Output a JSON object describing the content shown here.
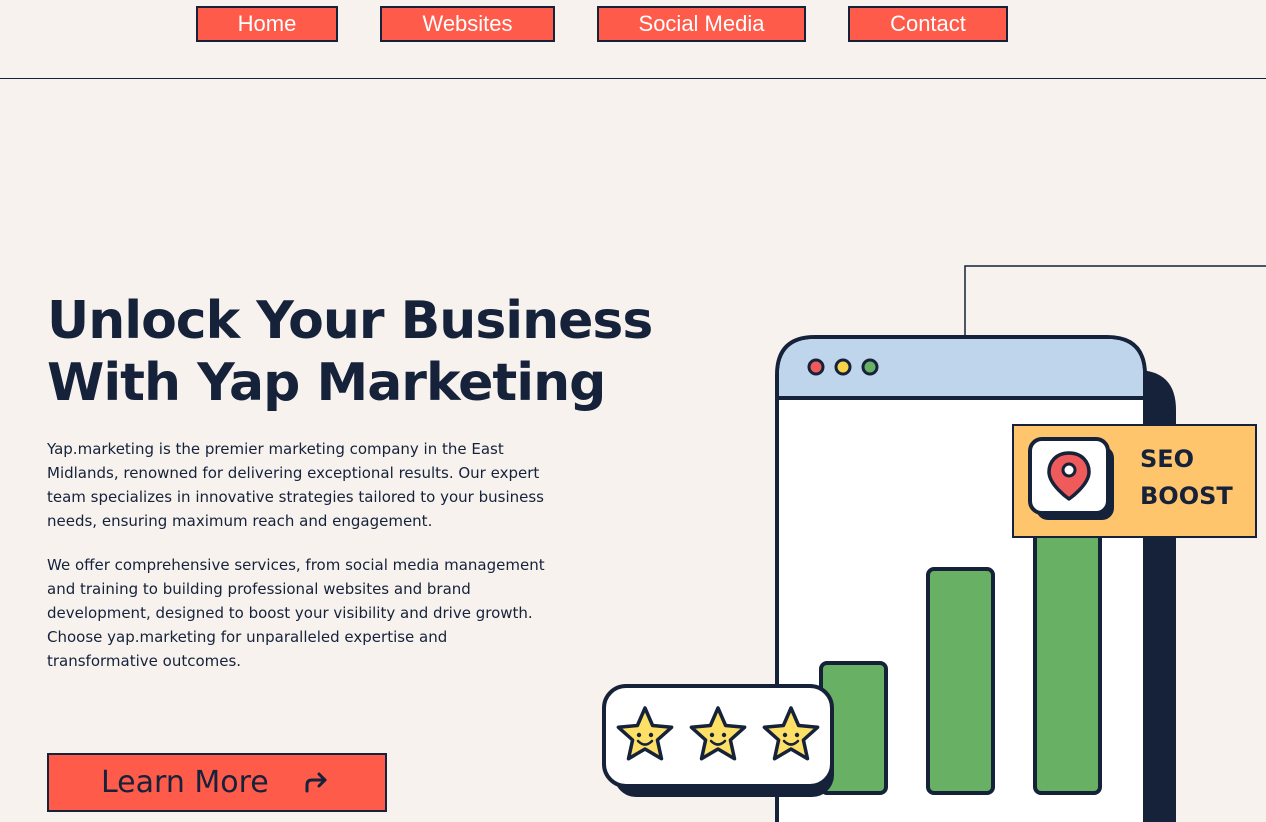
{
  "nav": {
    "items": [
      {
        "label": "Home"
      },
      {
        "label": "Websites"
      },
      {
        "label": "Social Media"
      },
      {
        "label": "Contact"
      }
    ]
  },
  "hero": {
    "title_line1": "Unlock Your Business",
    "title_line2": "With Yap Marketing",
    "paragraph1": "Yap.marketing is the premier marketing company in the East Midlands, renowned for delivering exceptional results. Our expert team specializes in innovative strategies tailored to your business needs, ensuring maximum reach and engagement.",
    "paragraph2": "We offer comprehensive services, from social media management and training to building professional websites and brand development, designed to boost your visibility and drive growth. Choose yap.marketing for unparalleled expertise and transformative outcomes.",
    "cta_label": "Learn More",
    "cta_icon": "redo-arrow-icon"
  },
  "illustration": {
    "badge_line1": "SEO",
    "badge_line2": "BOOST",
    "badge_icon": "map-pin-icon",
    "stars_count": 3
  },
  "colors": {
    "background": "#f7f2ee",
    "accent": "#ff5b4a",
    "navy": "#15223a",
    "green": "#68b064",
    "badge": "#ffc56d",
    "browser_header": "#bed5ec",
    "star": "#ffe066"
  }
}
